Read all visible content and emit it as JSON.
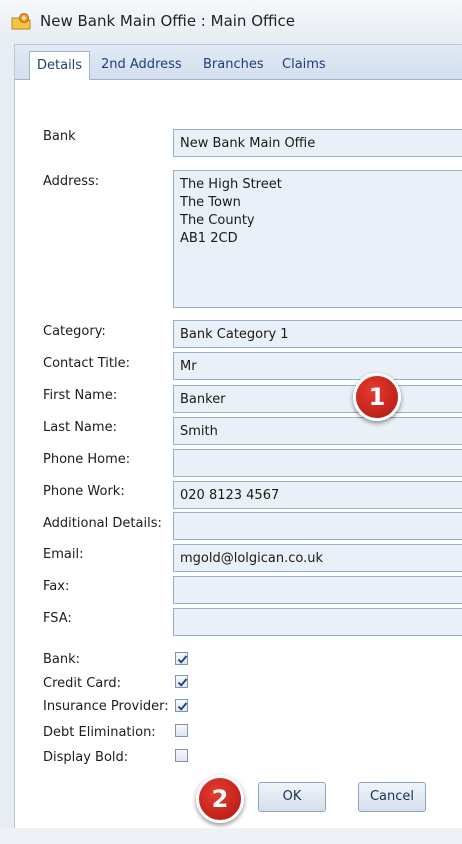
{
  "window": {
    "title": "New Bank Main Offie : Main Office"
  },
  "tabs": [
    {
      "label": "Details",
      "active": true
    },
    {
      "label": "2nd Address",
      "active": false
    },
    {
      "label": "Branches",
      "active": false
    },
    {
      "label": "Claims",
      "active": false
    }
  ],
  "form": {
    "bank": {
      "label": "Bank",
      "value": "New Bank Main Offie"
    },
    "address": {
      "label": "Address:",
      "lines": [
        "The High Street",
        "The Town",
        "The County",
        "AB1 2CD"
      ]
    },
    "category": {
      "label": "Category:",
      "value": "Bank Category 1"
    },
    "contact_title": {
      "label": "Contact Title:",
      "value": "Mr"
    },
    "first_name": {
      "label": "First Name:",
      "value": "Banker"
    },
    "last_name": {
      "label": "Last Name:",
      "value": "Smith"
    },
    "phone_home": {
      "label": "Phone Home:",
      "value": ""
    },
    "phone_work": {
      "label": "Phone Work:",
      "value": "020 8123 4567"
    },
    "additional_details": {
      "label": "Additional Details:",
      "value": ""
    },
    "email": {
      "label": "Email:",
      "value": "mgold@lolgican.co.uk"
    },
    "fax": {
      "label": "Fax:",
      "value": ""
    },
    "fsa": {
      "label": "FSA:",
      "value": ""
    }
  },
  "checkboxes": [
    {
      "label": "Bank:",
      "checked": true
    },
    {
      "label": "Credit Card:",
      "checked": true
    },
    {
      "label": "Insurance Provider:",
      "checked": true
    },
    {
      "label": "Debt Elimination:",
      "checked": false
    },
    {
      "label": "Display Bold:",
      "checked": false
    }
  ],
  "buttons": {
    "ok": "OK",
    "cancel": "Cancel"
  },
  "callouts": {
    "one": "1",
    "two": "2"
  },
  "colors": {
    "callout": "#c8251b",
    "tab_text": "#1d3f7a",
    "field_bg": "#eaf0f7"
  }
}
